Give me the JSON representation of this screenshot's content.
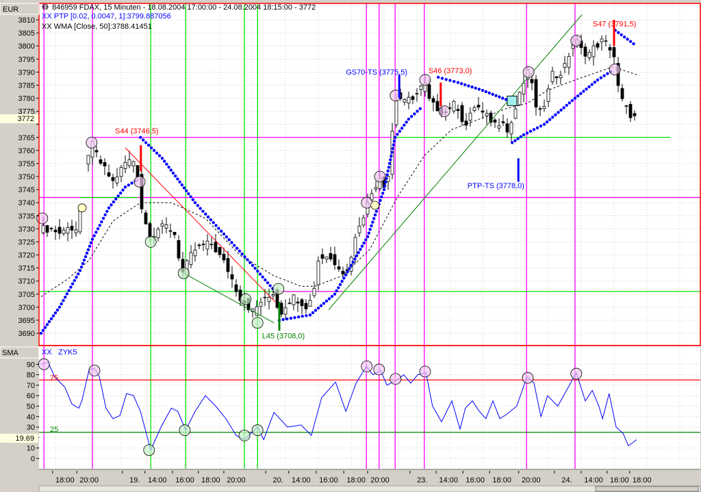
{
  "header": {
    "symbol_line": "846959  FDAX, 15 Minuten - 18.08.2004 17:00:00 - 24.08.2004 18:15:00 - 3772",
    "ptp_line": "XX PTP [0.02, 0.0047, 1]:3799.887056",
    "wma_line": "XX WMA [Close, 50]:3788.41451"
  },
  "price_panel": {
    "unit_label": "EUR",
    "current_value": "3772"
  },
  "osc_panel": {
    "label": "SMA",
    "legend_xx": "XX",
    "legend_name": "ZYK5",
    "current_value": "19.69",
    "upper_level": "75",
    "lower_level": "25"
  },
  "colors": {
    "ptp": "#0000ff",
    "wma": "#000000",
    "sell": "#ff0000",
    "buy": "#008000",
    "magenta": "#ff00ff",
    "green": "#00e000",
    "osc": "#0000ff"
  },
  "chart_data": [
    {
      "type": "candlestick",
      "title": "846959 FDAX, 15 Minuten",
      "ylim": [
        3690,
        3810
      ],
      "y_ticks": [
        "3810",
        "3805",
        "3800",
        "3795",
        "3790",
        "3785",
        "3780",
        "3775",
        "3770",
        "3765",
        "3760",
        "3755",
        "3750",
        "3745",
        "3740",
        "3735",
        "3730",
        "3725",
        "3720",
        "3715",
        "3710",
        "3705",
        "3700",
        "3695",
        "3690"
      ],
      "x_ticks": [
        {
          "bar": 6.3,
          "label": "18:00"
        },
        {
          "bar": 12.2,
          "label": "20:00"
        },
        {
          "bar": 23.3,
          "label": "19."
        },
        {
          "bar": 28.8,
          "label": "14:00"
        },
        {
          "bar": 35.5,
          "label": "16:00"
        },
        {
          "bar": 41.8,
          "label": "18:00"
        },
        {
          "bar": 48,
          "label": "20:00"
        },
        {
          "bar": 58.2,
          "label": "20."
        },
        {
          "bar": 63.8,
          "label": "14:00"
        },
        {
          "bar": 70.5,
          "label": "16:00"
        },
        {
          "bar": 77.2,
          "label": "18:00"
        },
        {
          "bar": 83,
          "label": "20:00"
        },
        {
          "bar": 93.3,
          "label": "23."
        },
        {
          "bar": 99.7,
          "label": "14:00"
        },
        {
          "bar": 106.2,
          "label": "16:00"
        },
        {
          "bar": 112.7,
          "label": "18:00"
        },
        {
          "bar": 119.8,
          "label": "20:00"
        },
        {
          "bar": 128.5,
          "label": "24."
        },
        {
          "bar": 135,
          "label": "14:00"
        },
        {
          "bar": 141.3,
          "label": "16:00"
        },
        {
          "bar": 146.8,
          "label": "18:00"
        }
      ],
      "close_path": [
        [
          0.5,
          3730
        ],
        [
          3,
          3730
        ],
        [
          5.5,
          3728
        ],
        [
          7.2,
          3732
        ],
        [
          8.8,
          3728
        ],
        [
          10.2,
          3738
        ],
        [
          11.3,
          3757
        ],
        [
          13,
          3762
        ],
        [
          14.7,
          3756
        ],
        [
          16.3,
          3752
        ],
        [
          18,
          3748
        ],
        [
          19.7,
          3752
        ],
        [
          21.3,
          3756
        ],
        [
          23,
          3756
        ],
        [
          24.2,
          3750
        ],
        [
          24.7,
          3740
        ],
        [
          26.3,
          3730
        ],
        [
          27.5,
          3727
        ],
        [
          28.8,
          3730
        ],
        [
          31.3,
          3731
        ],
        [
          33,
          3728
        ],
        [
          34.2,
          3718
        ],
        [
          35.2,
          3712
        ],
        [
          36.3,
          3718
        ],
        [
          38,
          3722
        ],
        [
          40.5,
          3724
        ],
        [
          42.2,
          3724
        ],
        [
          43.8,
          3720
        ],
        [
          45.5,
          3716
        ],
        [
          47.2,
          3710
        ],
        [
          48.8,
          3704
        ],
        [
          50.5,
          3701
        ],
        [
          52.2,
          3698
        ],
        [
          53.8,
          3702
        ],
        [
          55.5,
          3703
        ],
        [
          57.2,
          3706
        ],
        [
          58.5,
          3697
        ],
        [
          60.5,
          3702
        ],
        [
          62.2,
          3704
        ],
        [
          63.8,
          3702
        ],
        [
          65.5,
          3700
        ],
        [
          66.8,
          3706
        ],
        [
          68,
          3718
        ],
        [
          69.7,
          3720
        ],
        [
          71.3,
          3718
        ],
        [
          73,
          3716
        ],
        [
          74.7,
          3712
        ],
        [
          76.3,
          3722
        ],
        [
          78,
          3732
        ],
        [
          79.7,
          3738
        ],
        [
          81.3,
          3745
        ],
        [
          83,
          3750
        ],
        [
          84.7,
          3745
        ],
        [
          85.8,
          3765
        ],
        [
          87.2,
          3782
        ],
        [
          88.8,
          3778
        ],
        [
          90.5,
          3780
        ],
        [
          92.2,
          3782
        ],
        [
          93.8,
          3786
        ],
        [
          95.2,
          3778
        ],
        [
          97.2,
          3776
        ],
        [
          98.8,
          3774
        ],
        [
          100.5,
          3778
        ],
        [
          102.5,
          3776
        ],
        [
          103.5,
          3768
        ],
        [
          104.7,
          3772
        ],
        [
          106.3,
          3778
        ],
        [
          108,
          3774
        ],
        [
          109.7,
          3772
        ],
        [
          111.3,
          3770
        ],
        [
          113,
          3772
        ],
        [
          114.2,
          3766
        ],
        [
          115.2,
          3772
        ],
        [
          117.2,
          3782
        ],
        [
          118.8,
          3790
        ],
        [
          120.2,
          3786
        ],
        [
          121.3,
          3772
        ],
        [
          123,
          3778
        ],
        [
          124.7,
          3790
        ],
        [
          126.3,
          3788
        ],
        [
          128,
          3792
        ],
        [
          129.7,
          3800
        ],
        [
          130.8,
          3802
        ],
        [
          132.2,
          3798
        ],
        [
          133.8,
          3797
        ],
        [
          135.5,
          3800
        ],
        [
          137.2,
          3802
        ],
        [
          138.8,
          3800
        ],
        [
          140,
          3796
        ],
        [
          140.8,
          3785
        ],
        [
          142.2,
          3778
        ],
        [
          143.8,
          3774
        ],
        [
          145.5,
          3772
        ]
      ],
      "wma": [
        [
          0.5,
          3704
        ],
        [
          7.2,
          3711
        ],
        [
          12.2,
          3718
        ],
        [
          18,
          3733
        ],
        [
          24.7,
          3740
        ],
        [
          32.2,
          3740
        ],
        [
          40.5,
          3734
        ],
        [
          48.8,
          3720
        ],
        [
          57.2,
          3712
        ],
        [
          63.8,
          3708
        ],
        [
          67.2,
          3708
        ],
        [
          73.8,
          3712
        ],
        [
          80.5,
          3722
        ],
        [
          87.2,
          3742
        ],
        [
          93.8,
          3758
        ],
        [
          100.5,
          3768
        ],
        [
          107.2,
          3772
        ],
        [
          113.8,
          3776
        ],
        [
          118.8,
          3778
        ],
        [
          123.8,
          3783
        ],
        [
          130.5,
          3787
        ],
        [
          139.7,
          3792
        ],
        [
          145.5,
          3789
        ]
      ],
      "ptp_segments": [
        [
          [
            0.5,
            3690
          ],
          [
            5,
            3700
          ],
          [
            10,
            3714
          ],
          [
            13,
            3726
          ],
          [
            17,
            3738
          ],
          [
            21,
            3746
          ],
          [
            24.2,
            3749
          ]
        ],
        [
          [
            24.7,
            3765
          ],
          [
            30,
            3757
          ],
          [
            38,
            3740
          ],
          [
            45,
            3728
          ],
          [
            52,
            3716
          ],
          [
            57.5,
            3706
          ]
        ],
        [
          [
            58.5,
            3695
          ],
          [
            66,
            3697
          ],
          [
            72,
            3705
          ],
          [
            80,
            3727
          ],
          [
            84,
            3745
          ],
          [
            86.7,
            3765
          ],
          [
            90,
            3772
          ],
          [
            93.5,
            3777
          ]
        ],
        [
          [
            97.2,
            3788
          ],
          [
            102,
            3786
          ],
          [
            108,
            3783
          ],
          [
            114.5,
            3779
          ]
        ],
        [
          [
            115.2,
            3763
          ],
          [
            118,
            3766
          ],
          [
            123,
            3770
          ],
          [
            130.5,
            3780
          ],
          [
            136,
            3787
          ],
          [
            140,
            3791
          ]
        ],
        [
          [
            140.3,
            3806
          ],
          [
            145.5,
            3800
          ]
        ]
      ],
      "trendlines": [
        {
          "color": "sell",
          "from": [
            21,
            3761
          ],
          "to": [
            57.5,
            3702
          ]
        },
        {
          "color": "buy",
          "from": [
            35.2,
            3713
          ],
          "to": [
            57.2,
            3694
          ]
        },
        {
          "color": "buy",
          "from": [
            70.5,
            3699
          ],
          "to": [
            132.2,
            3812
          ]
        }
      ],
      "vlines_magenta": [
        1.2,
        13,
        79.7,
        82.8,
        86.7,
        93.8,
        118.7,
        130.5
      ],
      "vlines_green": [
        27.2,
        35.7,
        50,
        53.2
      ],
      "hlines": [
        {
          "color": "magenta",
          "price": 3765,
          "from": 13,
          "to": 86.7
        },
        {
          "color": "green",
          "price": 3765,
          "from": 86.7,
          "to": 153.8
        },
        {
          "color": "magenta",
          "price": 3742,
          "from": 0,
          "to": 161
        },
        {
          "color": "green",
          "price": 3742,
          "from": 10,
          "to": 24
        },
        {
          "color": "green",
          "price": 3706,
          "from": 0,
          "to": 161
        },
        {
          "color": "magenta",
          "price": 3706,
          "from": 57,
          "to": 74
        }
      ],
      "markers_pink": [
        [
          0.8,
          3734
        ],
        [
          12.8,
          3763
        ],
        [
          24.5,
          3748
        ],
        [
          79.8,
          3740
        ],
        [
          83,
          3750
        ],
        [
          86.8,
          3781
        ],
        [
          94,
          3787
        ],
        [
          98.7,
          3775
        ],
        [
          119.2,
          3790
        ],
        [
          130.8,
          3802
        ],
        [
          140.2,
          3791
        ]
      ],
      "markers_green": [
        [
          27.2,
          3725
        ],
        [
          35.2,
          3713
        ],
        [
          50.3,
          3703
        ],
        [
          53.2,
          3694
        ],
        [
          58.3,
          3707
        ]
      ],
      "markers_yellow": [
        [
          10.5,
          3738
        ],
        [
          81.8,
          3739
        ]
      ],
      "signal_bars": [
        {
          "color": "sell",
          "bar": 24.8,
          "from": 3762,
          "to": 3752
        },
        {
          "color": "ptp",
          "bar": 87.7,
          "from": 3789,
          "to": 3780
        },
        {
          "color": "sell",
          "bar": 97.8,
          "from": 3786,
          "to": 3777
        },
        {
          "color": "ptp",
          "bar": 116.7,
          "from": 3757,
          "to": 3748
        },
        {
          "color": "sell",
          "bar": 140,
          "from": 3810,
          "to": 3800
        },
        {
          "color": "buy",
          "bar": 58.5,
          "from": 3702,
          "to": 3691
        }
      ],
      "annotations": [
        {
          "text": "S44 (3746,5)",
          "color": "sell",
          "bar": 18.5,
          "price": 3766.5
        },
        {
          "text": "GS70-TS (3775,5)",
          "color": "ptp",
          "bar": 74.7,
          "price": 3789
        },
        {
          "text": "S46 (3773,0)",
          "color": "sell",
          "bar": 94.8,
          "price": 3789.5
        },
        {
          "text": "S47 (3791,5)",
          "color": "sell",
          "bar": 134.8,
          "price": 3807.5
        },
        {
          "text": "PTP-TS (3778,0)",
          "color": "ptp",
          "bar": 104.3,
          "price": 3745.5
        },
        {
          "text": "L45 (3708,0)",
          "color": "buy",
          "bar": 54.3,
          "price": 3688
        }
      ]
    },
    {
      "type": "line",
      "name": "ZYK5",
      "ylim": [
        0,
        90
      ],
      "y_ticks": [
        "90",
        "80",
        "70",
        "60",
        "50",
        "40",
        "30",
        "20",
        "10",
        "0"
      ],
      "levels": [
        75,
        25
      ],
      "x": [
        0.5,
        2.2,
        3.8,
        6.3,
        8,
        9.7,
        10.5,
        12.2,
        13.5,
        14.7,
        16.3,
        18,
        19.7,
        21.3,
        23,
        24.7,
        27.2,
        29.7,
        32.2,
        33.8,
        35.7,
        38,
        40.5,
        43,
        45.5,
        48,
        50,
        53.2,
        54.7,
        57.2,
        60.5,
        63.8,
        66.3,
        68.8,
        72.2,
        74.7,
        77.2,
        79.7,
        81.3,
        83.2,
        84.7,
        87.2,
        88.8,
        90.5,
        92.2,
        94.2,
        95.8,
        98,
        100.5,
        102.5,
        103.8,
        105.5,
        107.2,
        108.8,
        110.5,
        112.2,
        113.8,
        116.3,
        118.8,
        120.5,
        122.2,
        123.8,
        126.3,
        128,
        130.8,
        133,
        134.7,
        136.3,
        137.2,
        138.8,
        140.5,
        142.2,
        143.5,
        145.5
      ],
      "values": [
        90,
        92,
        78,
        68,
        52,
        48,
        56,
        85,
        86,
        78,
        48,
        38,
        41,
        62,
        60,
        45,
        8,
        30,
        48,
        45,
        27,
        45,
        60,
        50,
        38,
        22,
        18,
        30,
        18,
        44,
        30,
        32,
        22,
        58,
        73,
        45,
        72,
        88,
        80,
        84,
        70,
        75,
        80,
        72,
        80,
        82,
        50,
        35,
        55,
        28,
        48,
        55,
        45,
        38,
        55,
        38,
        42,
        50,
        78,
        72,
        40,
        60,
        50,
        62,
        82,
        55,
        65,
        50,
        38,
        62,
        30,
        24,
        12,
        18
      ],
      "markers_pink": [
        [
          1.2,
          90
        ],
        [
          13.5,
          84
        ],
        [
          79.8,
          88
        ],
        [
          82.8,
          85
        ],
        [
          86.8,
          76
        ],
        [
          94,
          83
        ],
        [
          119,
          77
        ],
        [
          130.8,
          81
        ]
      ],
      "markers_green": [
        [
          26.8,
          8
        ],
        [
          35.5,
          27
        ],
        [
          50,
          22
        ],
        [
          53.2,
          27
        ]
      ]
    }
  ]
}
